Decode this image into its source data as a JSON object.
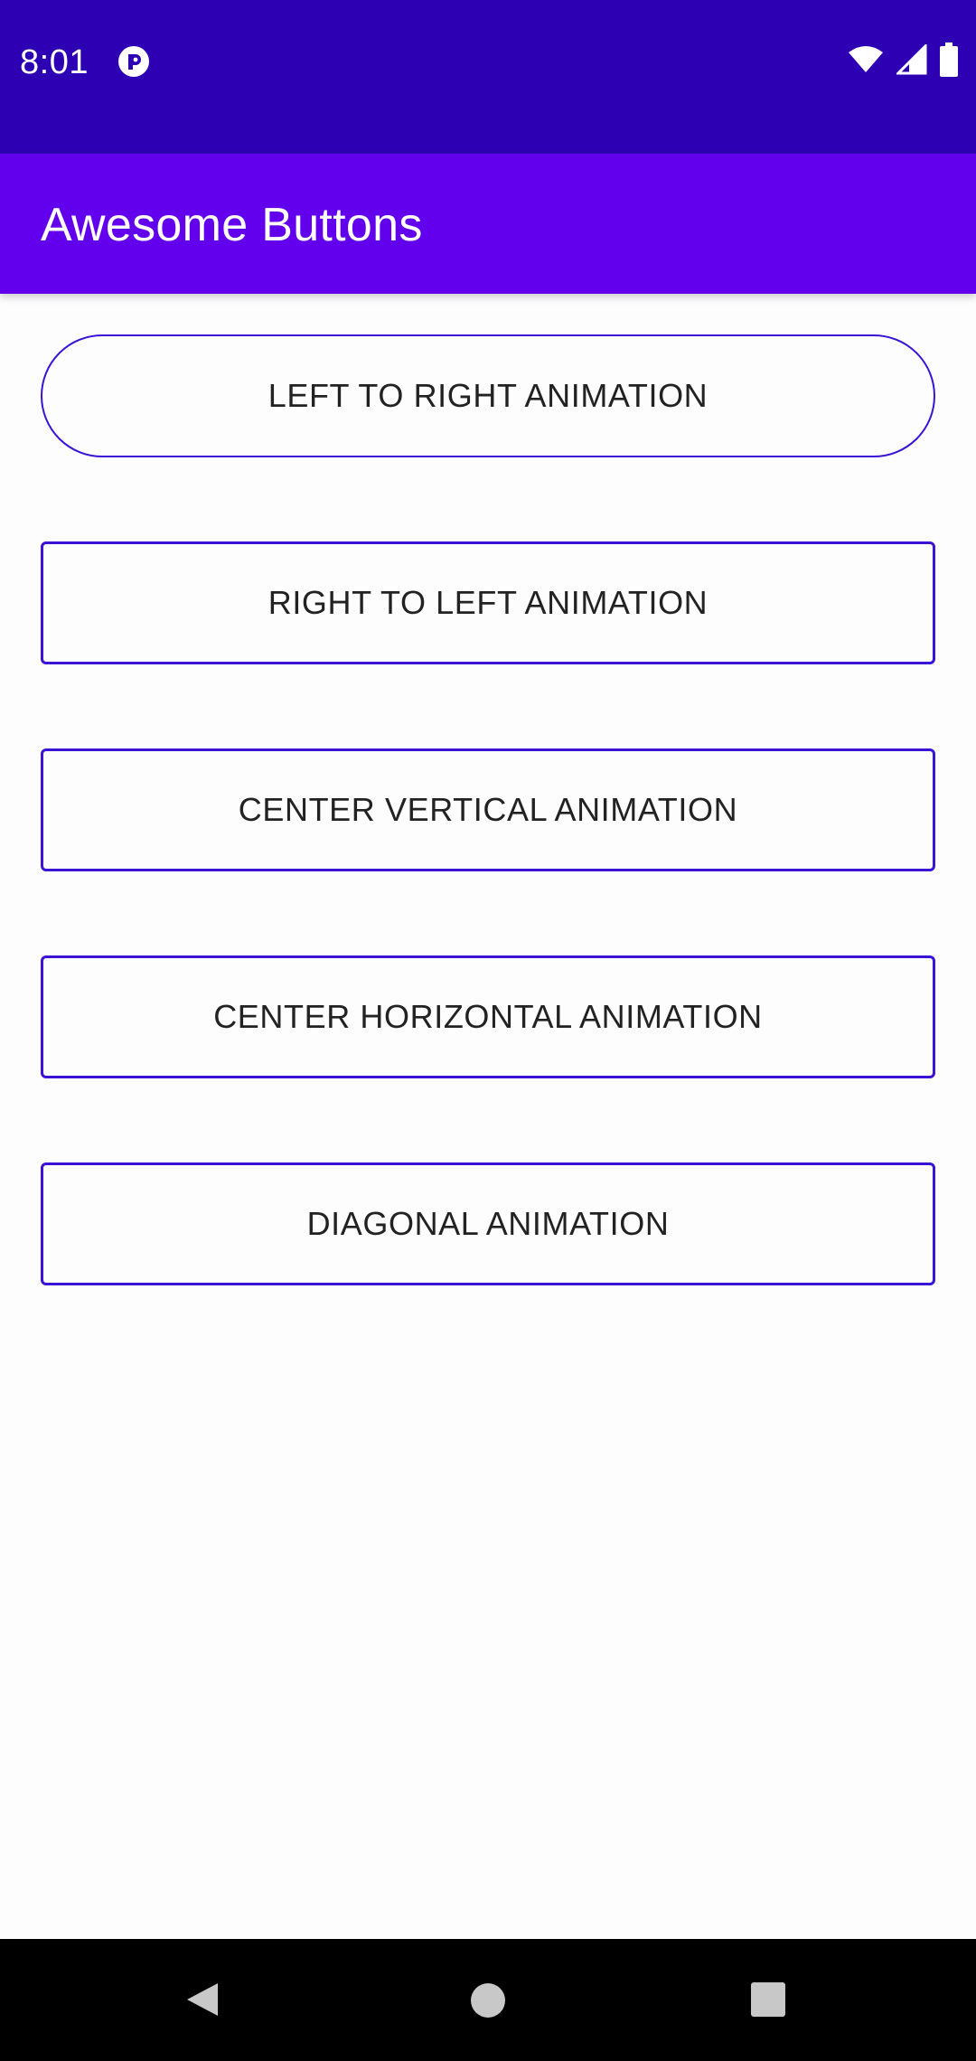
{
  "status_bar": {
    "time": "8:01",
    "icons": [
      "app-notification-icon",
      "wifi-icon",
      "cellular-signal-icon",
      "battery-icon"
    ],
    "background": "#2e00b3"
  },
  "app_bar": {
    "title": "Awesome Buttons",
    "background": "#6200ee"
  },
  "buttons": [
    {
      "label": "LEFT TO RIGHT ANIMATION",
      "shape": "pill"
    },
    {
      "label": "RIGHT TO LEFT ANIMATION",
      "shape": "rect"
    },
    {
      "label": "CENTER VERTICAL ANIMATION",
      "shape": "rect"
    },
    {
      "label": "CENTER HORIZONTAL ANIMATION",
      "shape": "rect"
    },
    {
      "label": "DIAGONAL ANIMATION",
      "shape": "rect"
    }
  ],
  "colors": {
    "button_border": "#3a13d6",
    "button_text": "#222222",
    "page_background": "#fdfdfe"
  },
  "nav_bar": {
    "icons": [
      "back-icon",
      "home-icon",
      "recents-icon"
    ]
  }
}
